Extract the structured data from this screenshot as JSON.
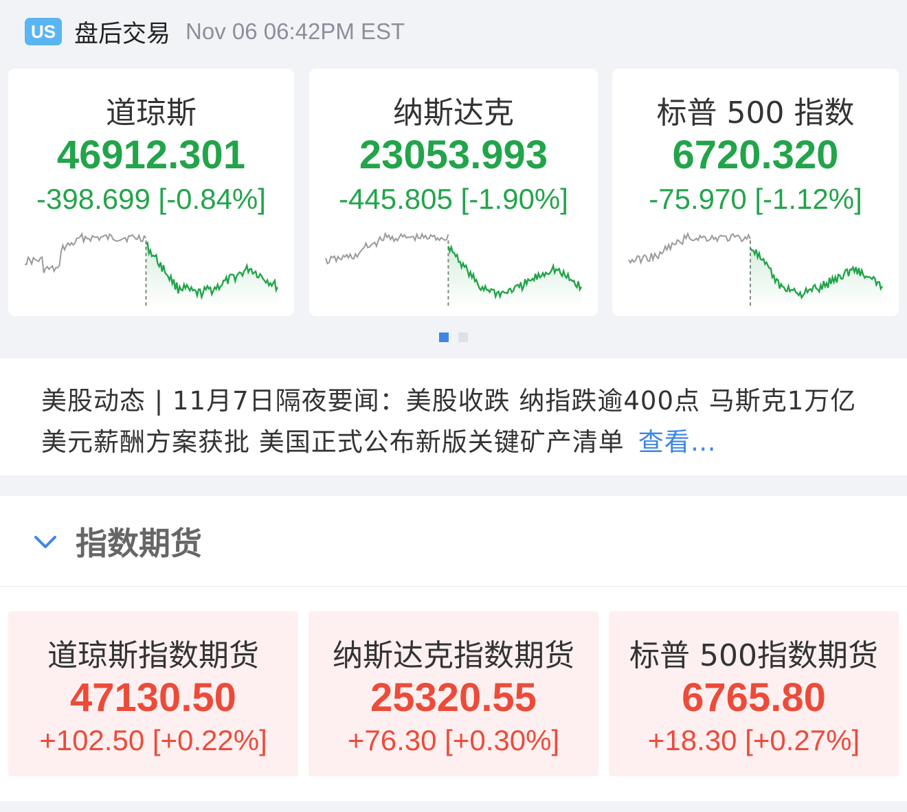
{
  "header": {
    "badge": "US",
    "title": "盘后交易",
    "time": "Nov 06 06:42PM EST"
  },
  "indices": [
    {
      "name": "道琼斯",
      "value": "46912.301",
      "change": "-398.699 [-0.84%]"
    },
    {
      "name": "纳斯达克",
      "value": "23053.993",
      "change": "-445.805 [-1.90%]"
    },
    {
      "name": "标普 500 指数",
      "value": "6720.320",
      "change": "-75.970 [-1.12%]"
    }
  ],
  "pager": {
    "pages": 2,
    "active": 1
  },
  "news": {
    "text": "美股动态 | 11月7日隔夜要闻：美股收跌 纳指跌逾400点 马斯克1万亿美元薪酬方案获批 美国正式公布新版关键矿产清单",
    "link": "查看…"
  },
  "futures_section": {
    "title": "指数期货",
    "items": [
      {
        "name": "道琼斯指数期货",
        "value": "47130.50",
        "change": "+102.50 [+0.22%]"
      },
      {
        "name": "纳斯达克指数期货",
        "value": "25320.55",
        "change": "+76.30 [+0.30%]"
      },
      {
        "name": "标普 500指数期货",
        "value": "6765.80",
        "change": "+18.30 [+0.27%]"
      }
    ]
  },
  "colors": {
    "down": "#22a44a",
    "up": "#ec4b3a",
    "accent": "#3d86e6",
    "premarket_line": "#9a9a9a"
  },
  "icons": [
    "chevron-down-icon"
  ]
}
